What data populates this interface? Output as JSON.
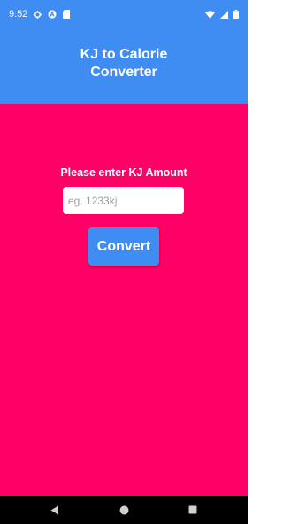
{
  "status_bar": {
    "time": "9:52",
    "icons_left": [
      "gear-icon",
      "app-a-icon",
      "sd-card-icon"
    ],
    "icons_right": [
      "wifi-icon",
      "signal-icon",
      "battery-icon"
    ]
  },
  "app_bar": {
    "title": "KJ to Calorie Converter"
  },
  "form": {
    "prompt": "Please enter KJ Amount",
    "input_value": "",
    "input_placeholder": "eg. 1233kj",
    "button_label": "Convert"
  },
  "nav_bar": {
    "buttons": [
      "back-icon",
      "home-icon",
      "recents-icon"
    ]
  },
  "colors": {
    "background": "#ff0066",
    "accent": "#3f8cf2",
    "input_bg": "#ffffff",
    "placeholder": "#9e9e9e",
    "nav_bar": "#000000"
  }
}
